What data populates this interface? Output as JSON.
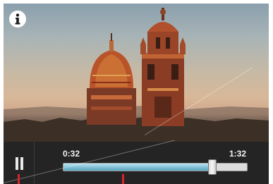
{
  "player": {
    "info_icon": "info-icon",
    "pause_icon": "pause-icon",
    "current_time": "0:32",
    "duration": "1:32",
    "progress_fraction": 0.81,
    "accent_color": "#7fc0d6"
  }
}
